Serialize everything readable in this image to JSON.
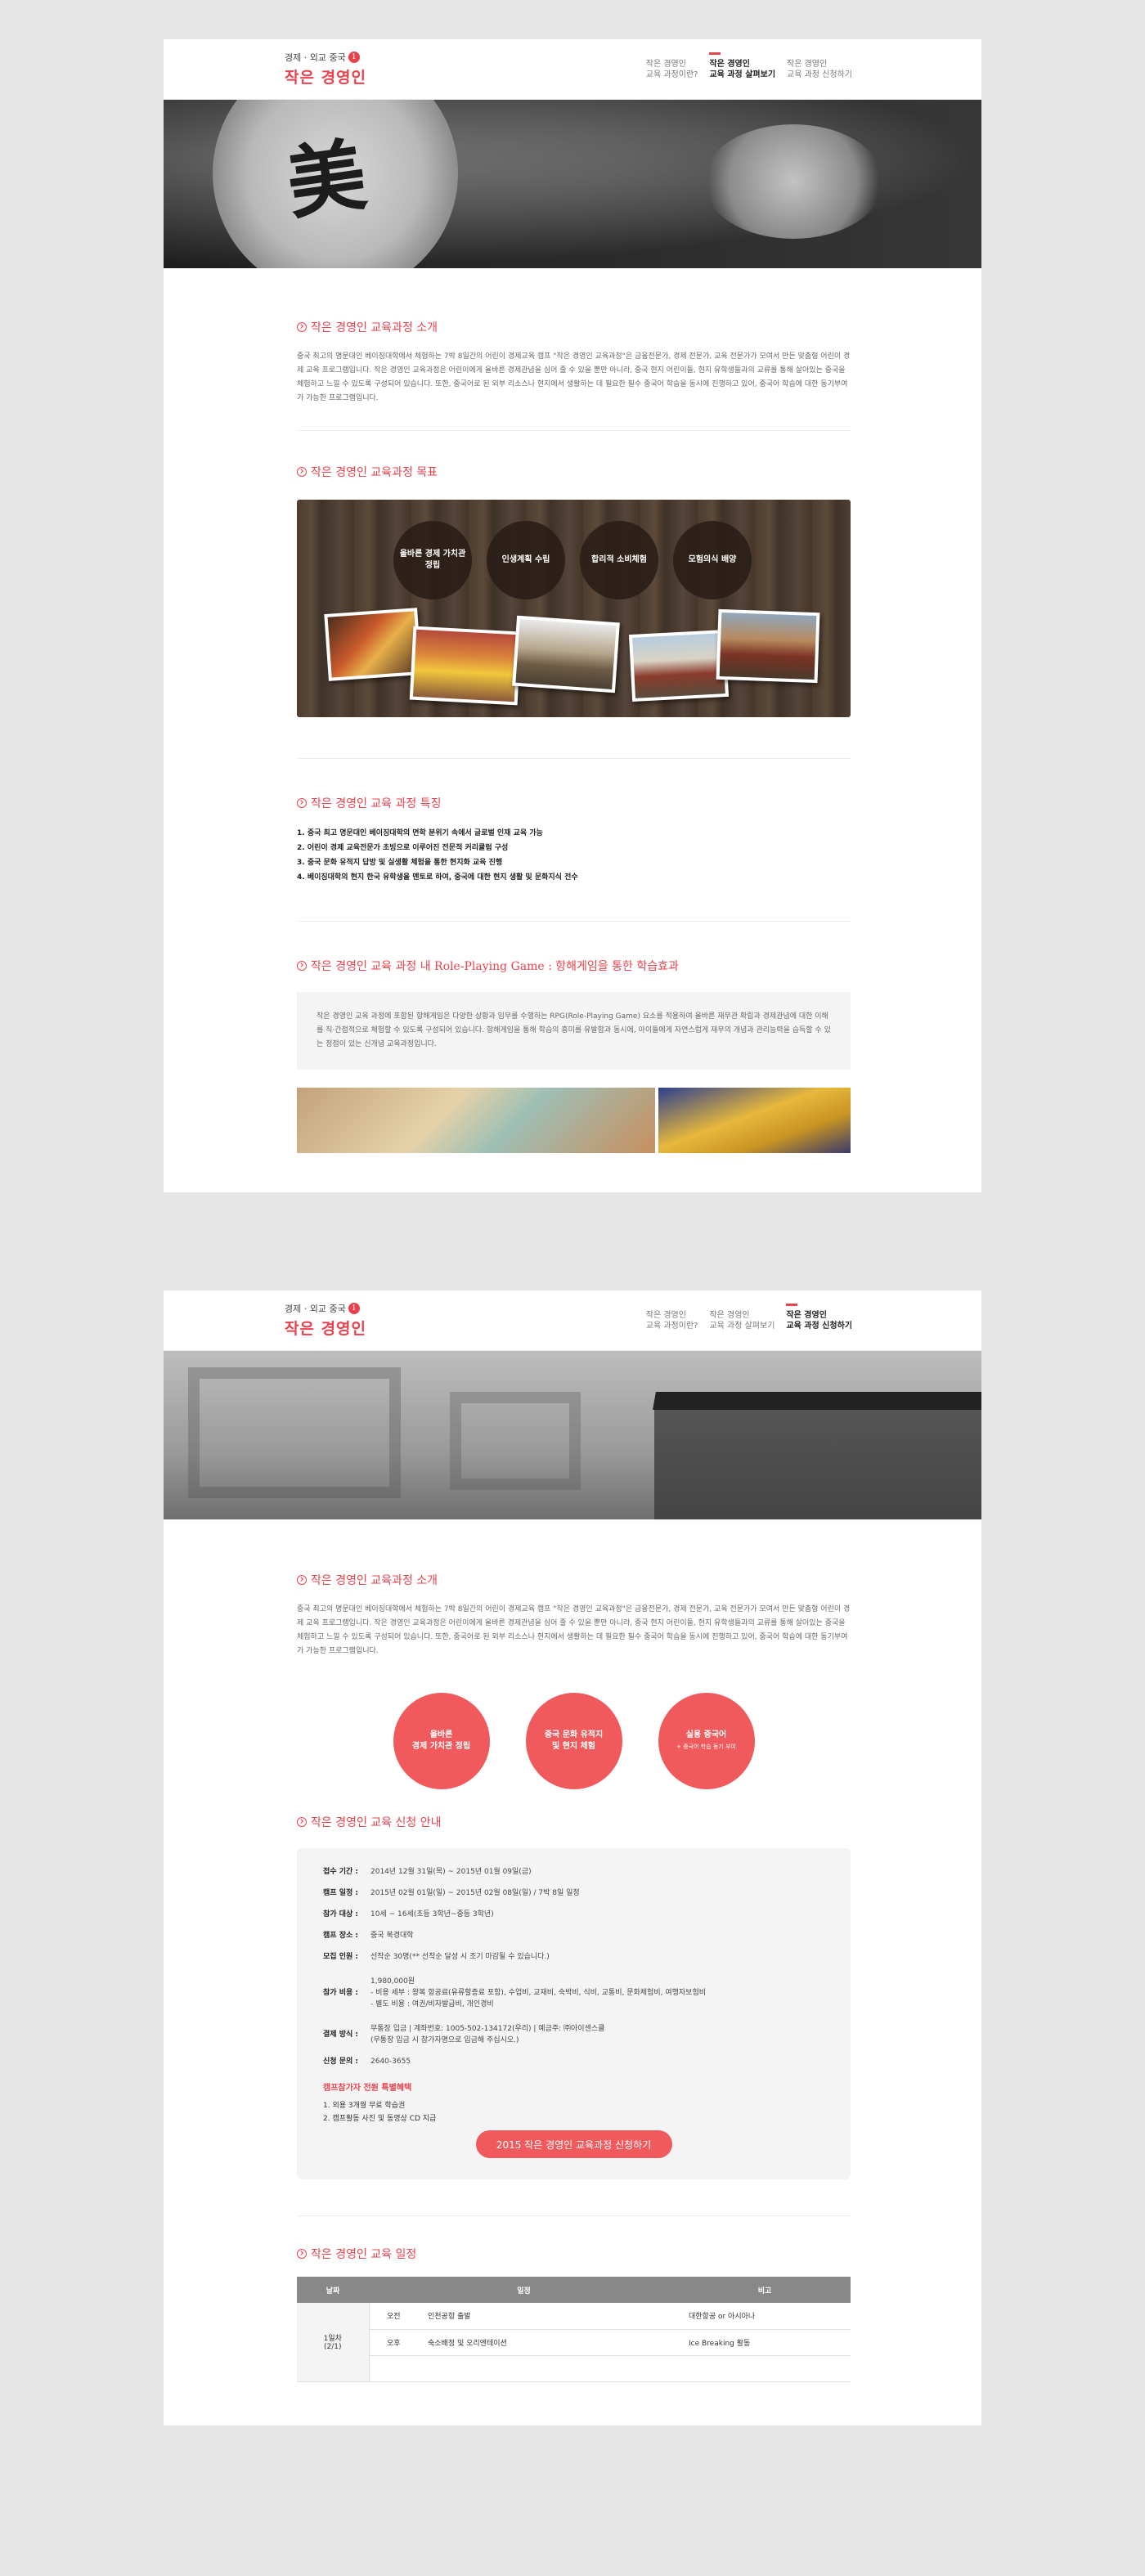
{
  "logo": {
    "sub": "경제 · 외교 중국",
    "badge": "1",
    "main": "작은 경영인"
  },
  "nav": [
    {
      "line1": "작은 경영인",
      "line2": "교육 과정이란?"
    },
    {
      "line1": "작은 경영인",
      "line2": "교육 과정 살펴보기"
    },
    {
      "line1": "작은 경영인",
      "line2": "교육 과정 신청하기"
    }
  ],
  "hero1": {
    "glyph": "美"
  },
  "page1": {
    "intro": {
      "title": "작은 경영인 교육과정 소개",
      "text": "중국 최고의 명문대인 베이징대학에서 체험하는 7박 8일간의 어린이 경제교육 캠프 \"작은 경영인 교육과정\"은 금융전문가, 경제 전문가, 교육 전문가가 모여서 만든 맞춤형 어린이 경제 교육 프로그램입니다. 작은 경영인 교육과정은 어린이에게 올바른 경제관념을 심어 줄 수 있을 뿐만 아니라, 중국 현지 어린이들, 현지 유학생들과의 교류를 통해 살아있는 중국을 체험하고 느낄 수 있도록 구성되어 있습니다. 또한, 중국어로 된 외부 리소스나 현지에서 생활하는 데 필요한 필수 중국어 학습을 동시에 진행하고 있어, 중국어 학습에 대한 동기부여가 가능한 프로그램입니다."
    },
    "goals": {
      "title": "작은 경영인 교육과정 목표",
      "items": [
        "올바른 경제 가치관 정립",
        "인생계획 수립",
        "합리적 소비체험",
        "모험의식 배양"
      ]
    },
    "features": {
      "title": "작은 경영인 교육 과정 특징",
      "items": [
        "1. 중국 최고 명문대인 베이징대학의 면학 분위기 속에서 글로벌 인재 교육 가능",
        "2. 어린이 경제 교육전문가 초빙으로 이루어진 전문적 커리큘럼 구성",
        "3. 중국 문화 유적지 답방 및 실생활 체험을 통한 현지화 교육 진행",
        "4. 베이징대학의 현지 한국 유학생을 멘토로 하여, 중국에 대한 현지 생활 및 문화지식 전수"
      ]
    },
    "rpg": {
      "title": "작은 경영인 교육 과정 내 Role-Playing Game : 항해게임을 통한 학습효과",
      "text": "작은 경영인 교육 과정에 포함된 항해게임은 다양한 상황과 임무를 수행하는 RPG(Role-Playing Game) 요소를 적용하여 올바른 재무관 확립과 경제관념에 대한 이해를 직·간접적으로 체험할 수 있도록 구성되어 있습니다. 항해게임을 통해 학습의 흥미를 유발함과 동시에, 아이들에게 자연스럽게 재무의 개념과 관리능력을 습득할 수 있는 정점이 있는 신개념 교육과정입니다."
    }
  },
  "page2": {
    "intro": {
      "title": "작은 경영인 교육과정 소개",
      "text": "중국 최고의 명문대인 베이징대학에서 체험하는 7박 8일간의 어린이 경제교육 캠프 \"작은 경영인 교육과정\"은 금융전문가, 경제 전문가, 교육 전문가가 모여서 만든 맞춤형 어린이 경제 교육 프로그램입니다. 작은 경영인 교육과정은 어린이에게 올바른 경제관념을 심어 줄 수 있을 뿐만 아니라, 중국 현지 어린이들, 현지 유학생들과의 교류를 통해 살아있는 중국을 체험하고 느낄 수 있도록 구성되어 있습니다. 또한, 중국어로 된 외부 리소스나 현지에서 생활하는 데 필요한 필수 중국어 학습을 동시에 진행하고 있어, 중국어 학습에 대한 동기부여가 가능한 프로그램입니다."
    },
    "circles": [
      {
        "line1": "올바른",
        "line2": "경제 가치관 정립",
        "small": ""
      },
      {
        "line1": "중국 문화 유적지",
        "line2": "및 현지 체험",
        "small": ""
      },
      {
        "line1": "실용 중국어",
        "line2": "",
        "small": "+ 중국어 학습 동기 부여"
      }
    ],
    "apply": {
      "title": "작은 경영인 교육 신청 안내",
      "rows": [
        {
          "k": "접수 기간 :",
          "v": "2014년 12월 31일(목) ~ 2015년 01월 09일(금)"
        },
        {
          "k": "캠프 일정 :",
          "v": "2015년 02월 01일(일) ~ 2015년 02월 08일(일) / 7박 8일 일정"
        },
        {
          "k": "참가 대상 :",
          "v": "10세 ~ 16세(초등 3학년~중등 3학년)"
        },
        {
          "k": "캠프 장소 :",
          "v": "중국 북경대학"
        },
        {
          "k": "모집 인원 :",
          "v": "선착순 30명(** 선착순 달성 시 조기 마감될 수 있습니다.)"
        }
      ],
      "fee_key": "참가 비용 :",
      "fee_lines": [
        "1,980,000원",
        "- 비용 세부 : 왕복 항공료(유류할증료 포함), 수업비, 교재비, 숙박비, 식비, 교통비, 문화체험비, 여행자보험비",
        "- 별도 비용 : 여권/비자발급비, 개인경비"
      ],
      "pay_key": "결제 방식 :",
      "pay_lines": [
        "무통장 입금 | 계좌번호: 1005-502-134172(우리) | 예금주: ㈜아이센스클",
        "(무통장 입금 시 참가자명으로 입금해 주십시오.)"
      ],
      "contact_key": "신청 문의 :",
      "contact": "2640-3655",
      "benefit_title": "캠프참가자 전원 특별혜택",
      "benefits": [
        "1. 외용 3개월 무료 학습권",
        "2. 캠프활동 사진 및 동영상 CD 지급"
      ],
      "button": "2015 작은 경영인 교육과정 신청하기"
    },
    "schedule": {
      "title": "작은 경영인 교육 일정",
      "headers": [
        "날짜",
        "일정",
        "비고"
      ],
      "day": "1일차",
      "date": "(2/1)",
      "rows": [
        {
          "time": "오전",
          "plan": "인천공항 출발",
          "note": "대한항공 or 아시아나"
        },
        {
          "time": "오후",
          "plan": "숙소배정 및 오리엔테이션",
          "note": "Ice Breaking 활동"
        },
        {
          "time": "",
          "plan": "",
          "note": ""
        }
      ]
    }
  },
  "colors": {
    "accent": "#e8434d",
    "circle": "#f05a5d"
  }
}
